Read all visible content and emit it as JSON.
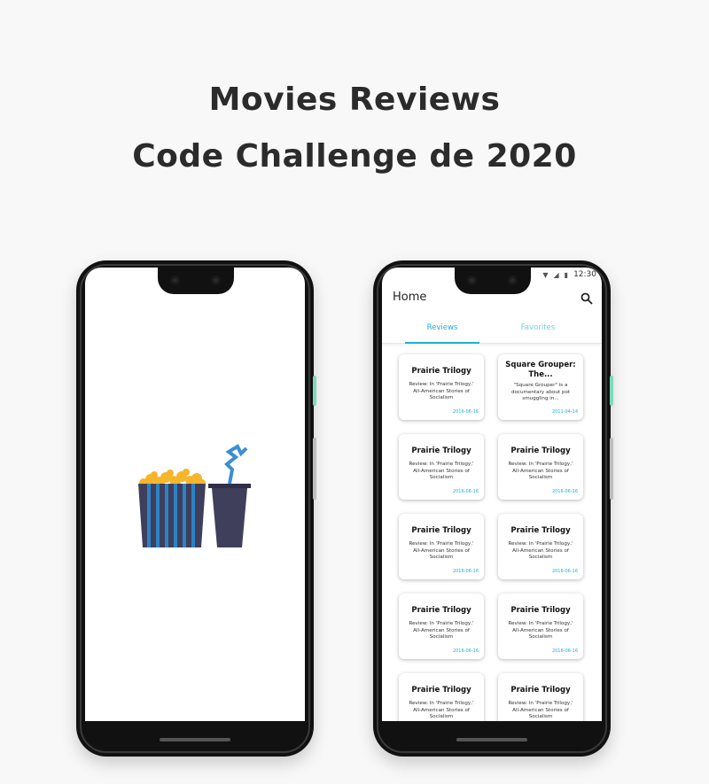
{
  "headline": {
    "line1": "Movies Reviews",
    "line2": "Code Challenge de 2020"
  },
  "colors": {
    "accent": "#1cb1d6",
    "popcorn": "#f7b52c",
    "bucket_stripe": "#2b83c6",
    "cup": "#3f3f5c",
    "straw": "#3a8fd6"
  },
  "status_bar": {
    "time": "12:30",
    "icons": [
      "wifi-icon",
      "signal-icon",
      "battery-icon"
    ]
  },
  "app": {
    "title": "Home",
    "tabs": [
      {
        "label": "Reviews",
        "selected": true
      },
      {
        "label": "Favorites",
        "selected": false
      }
    ]
  },
  "cards": [
    {
      "title": "Prairie Trilogy",
      "body": "Review: In 'Prairie Trilogy,' All-American Stories of Socialism",
      "date": "2016-06-16"
    },
    {
      "title": "Square Grouper: The...",
      "body": "\"Square Grouper\" is a documentary about pot smuggling in...",
      "date": "2011-04-14"
    },
    {
      "title": "Prairie Trilogy",
      "body": "Review: In 'Prairie Trilogy,' All-American Stories of Socialism",
      "date": "2016-06-16"
    },
    {
      "title": "Prairie Trilogy",
      "body": "Review: In 'Prairie Trilogy,' All-American Stories of Socialism",
      "date": "2016-06-16"
    },
    {
      "title": "Prairie Trilogy",
      "body": "Review: In 'Prairie Trilogy,' All-American Stories of Socialism",
      "date": "2016-06-16"
    },
    {
      "title": "Prairie Trilogy",
      "body": "Review: In 'Prairie Trilogy,' All-American Stories of Socialism",
      "date": "2016-06-16"
    },
    {
      "title": "Prairie Trilogy",
      "body": "Review: In 'Prairie Trilogy,' All-American Stories of Socialism",
      "date": "2016-06-16"
    },
    {
      "title": "Prairie Trilogy",
      "body": "Review: In 'Prairie Trilogy,' All-American Stories of Socialism",
      "date": "2016-06-16"
    },
    {
      "title": "Prairie Trilogy",
      "body": "Review: In 'Prairie Trilogy,' All-American Stories of Socialism",
      "date": ""
    },
    {
      "title": "Prairie Trilogy",
      "body": "Review: In 'Prairie Trilogy,' All-American Stories of Socialism",
      "date": ""
    }
  ]
}
